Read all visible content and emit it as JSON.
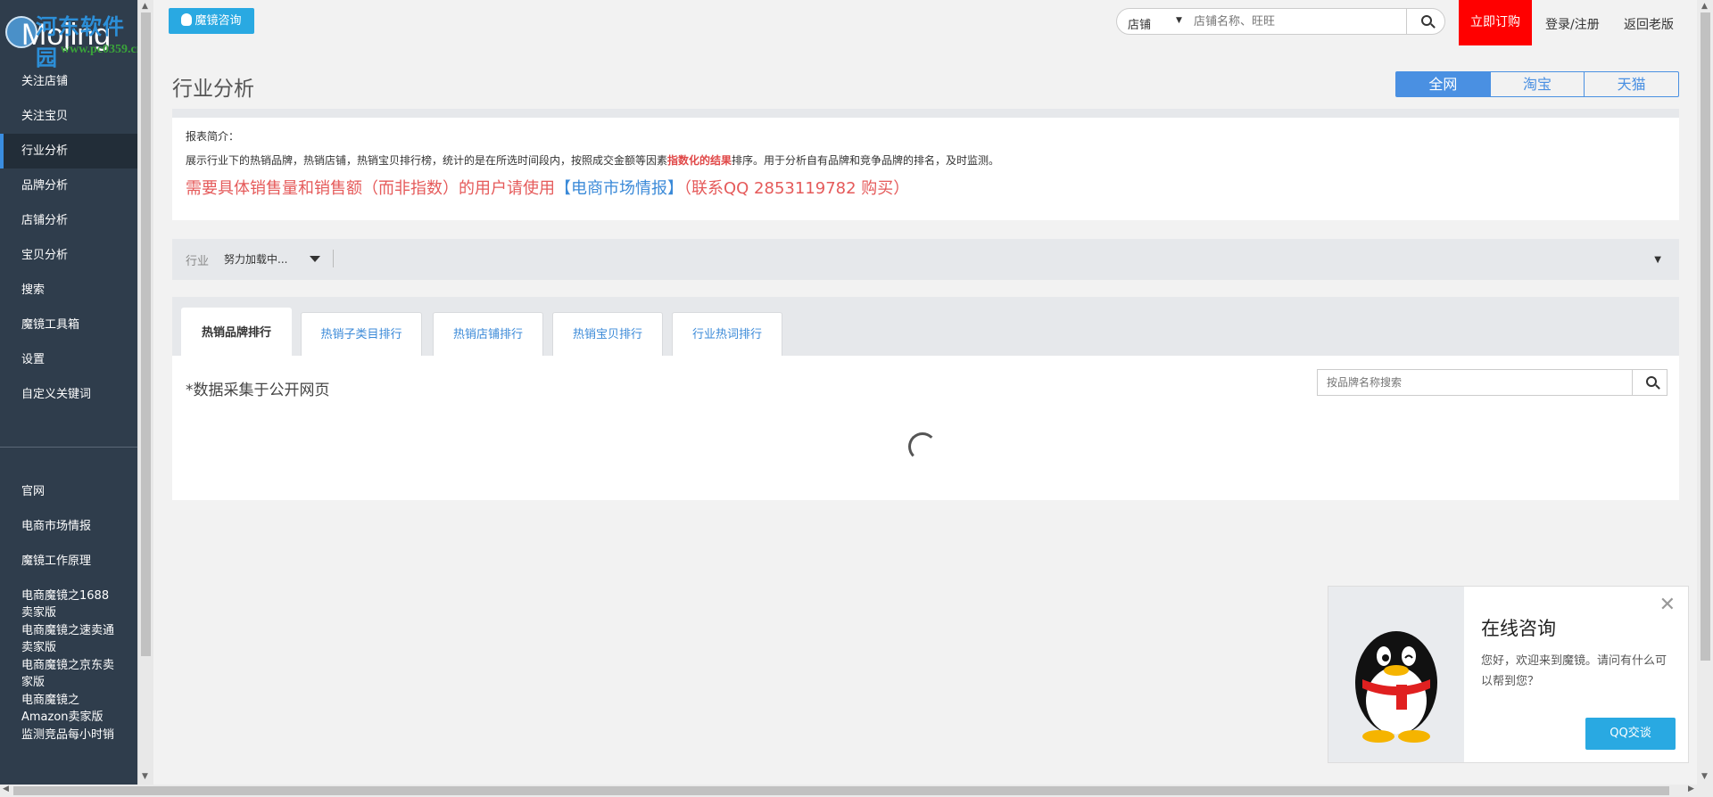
{
  "logo": {
    "watermark": "河东软件园",
    "brand": "Mojing",
    "url": "www.pc0359.cn"
  },
  "sidebar": {
    "items": [
      {
        "label": "关注店铺"
      },
      {
        "label": "关注宝贝"
      },
      {
        "label": "行业分析",
        "active": true
      },
      {
        "label": "品牌分析"
      },
      {
        "label": "店铺分析"
      },
      {
        "label": "宝贝分析"
      },
      {
        "label": "搜索"
      },
      {
        "label": "魔镜工具箱"
      },
      {
        "label": "设置"
      },
      {
        "label": "自定义关键词"
      }
    ],
    "links": [
      {
        "label": "官网"
      },
      {
        "label": "电商市场情报"
      },
      {
        "label": "魔镜工作原理"
      },
      {
        "label": "电商魔镜之1688卖家版"
      },
      {
        "label": "电商魔镜之速卖通卖家版"
      },
      {
        "label": "电商魔镜之京东卖家版"
      },
      {
        "label": "电商魔镜之Amazon卖家版"
      },
      {
        "label": "监测竞品每小时销"
      }
    ]
  },
  "header": {
    "consult_label": "魔镜咨询",
    "search_type": "店铺",
    "search_placeholder": "店铺名称、旺旺",
    "order_label": "立即订购",
    "login_label": "登录/注册",
    "back_label": "返回老版"
  },
  "page": {
    "title": "行业分析",
    "segments": [
      {
        "label": "全网",
        "active": true
      },
      {
        "label": "淘宝"
      },
      {
        "label": "天猫"
      }
    ]
  },
  "info": {
    "heading": "报表简介：",
    "desc_before": "展示行业下的热销品牌，热销店铺，热销宝贝排行榜，统计的是在所选时间段内，按照成交金额等因素",
    "desc_highlight": "指数化的结果",
    "desc_after": "排序。用于分析自有品牌和竞争品牌的排名，及时监测。",
    "promo_before": "需要具体销售量和销售额（而非指数）的用户请使用",
    "promo_link": "【电商市场情报】",
    "promo_after": "（联系QQ 2853119782 购买）"
  },
  "filter": {
    "label": "行业",
    "value": "努力加载中..."
  },
  "tabs": [
    {
      "label": "热销品牌排行",
      "active": true
    },
    {
      "label": "热销子类目排行"
    },
    {
      "label": "热销店铺排行"
    },
    {
      "label": "热销宝贝排行"
    },
    {
      "label": "行业热词排行"
    }
  ],
  "panel": {
    "note": "*数据采集于公开网页",
    "search_placeholder": "按品牌名称搜索"
  },
  "chat": {
    "title": "在线咨询",
    "message": "您好，欢迎来到魔镜。请问有什么可以帮到您？",
    "button": "QQ交谈"
  },
  "colors": {
    "sidebar": "#2f3d4c",
    "accent": "#4a90e2",
    "order": "#ff0000",
    "qq": "#29a9e2"
  }
}
